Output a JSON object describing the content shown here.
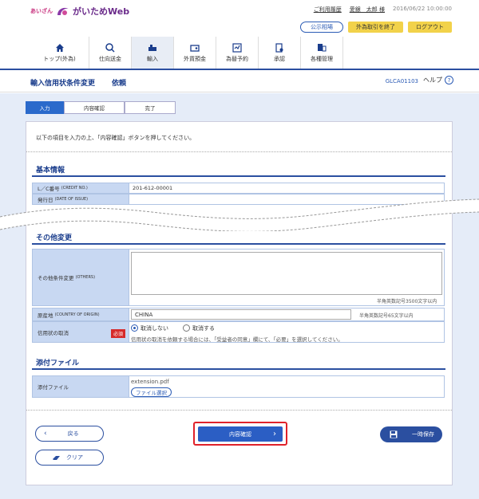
{
  "header": {
    "bank_name": "あいざん",
    "app_name": "がいためWeb",
    "usage_history": "ご利用履歴",
    "user_name": "愛銀　太郎 様",
    "datetime": "2016/06/22 10:00:00",
    "public_rates": "公示相場",
    "end_fx": "外為取引を終了",
    "logout": "ログアウト"
  },
  "nav": [
    {
      "label": "トップ(外為)",
      "icon": "home-icon"
    },
    {
      "label": "仕向送金",
      "icon": "remittance-icon"
    },
    {
      "label": "輸入",
      "icon": "import-icon"
    },
    {
      "label": "外貨預金",
      "icon": "deposit-icon"
    },
    {
      "label": "為替予約",
      "icon": "exchange-icon"
    },
    {
      "label": "承認",
      "icon": "approval-icon"
    },
    {
      "label": "各種管理",
      "icon": "admin-icon"
    }
  ],
  "title": {
    "main": "輸入信用状条件変更",
    "sub": "依頼",
    "screen_id": "GLCA01103",
    "help": "ヘルプ"
  },
  "steps": [
    "入力",
    "内容確認",
    "完了"
  ],
  "instruction": "以下の項目を入力の上、「内容確認」ボタンを押してください。",
  "basic": {
    "heading": "基本情報",
    "lc_label": "L／C番号",
    "lc_label_en": "(CREDIT NO.)",
    "lc_value": "201-612-00001",
    "issue_label": "発行日",
    "issue_label_en": "(DATE OF ISSUE)"
  },
  "other": {
    "heading": "その他変更",
    "others_label": "その他条件変更",
    "others_label_en": "(OTHERS)",
    "others_note": "半角英数記号3500文字以内",
    "origin_label": "原産地",
    "origin_label_en": "(COUNTRY OF ORIGIN)",
    "origin_value": "CHINA",
    "origin_note": "半角英数記号65文字以内",
    "cancel_label": "信用状の取消",
    "required": "必須",
    "opt_no": "取消しない",
    "opt_yes": "取消する",
    "cancel_note": "信用状の取消を依頼する場合には、「受益者の同意」欄にて、「必要」を選択してください。"
  },
  "attach": {
    "heading": "添付ファイル",
    "label": "添付ファイル",
    "filename": "extension.pdf",
    "select": "ファイル選択"
  },
  "buttons": {
    "back": "戻る",
    "clear": "クリア",
    "confirm": "内容確認",
    "save": "一時保存"
  }
}
